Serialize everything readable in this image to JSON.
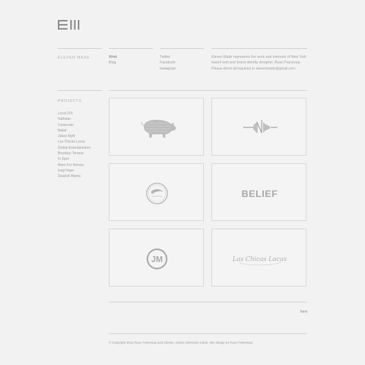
{
  "brand": {
    "name": "ELEVEN MADE"
  },
  "nav": {
    "primary": [
      "Work",
      "Blog"
    ],
    "social": [
      "Twitter",
      "Facebook",
      "Instagram"
    ]
  },
  "about": {
    "line1": "Eleven Made represents the work and interests of New York",
    "line2": "based web and brand identity designer, Ryan Pasnesaa.",
    "line3": "Please direct all inquiries to elevenmade@gmail.com"
  },
  "projects": {
    "title": "PROJECTS",
    "items": [
      "Local 215",
      "Nathaan",
      "Centerolio",
      "Belief",
      "Jokes Myth",
      "Las Chicas Locas",
      "Global Entertainment",
      "Brooklyn Terrace",
      "In Spot",
      "Bees For Heroes",
      "Iraqi Hope",
      "Seasick Mama"
    ]
  },
  "tiles": {
    "belief_wordmark": "BELIEF",
    "jm_monogram": "JM",
    "script_wordmark": "Las Chicas Locas"
  },
  "pagination": {
    "next": "Next"
  },
  "footer": {
    "text": "© Copyright 2012 Ryan Pasnesaa and Clients, unless otherwise noted. Site design by Ryan Pasnesaa."
  },
  "colors": {
    "background": "#f2f2f2",
    "text": "#9a9a9a",
    "rule": "#cfcfcf",
    "tile_border": "#d6d6d6",
    "logo": "#8c8c8c"
  }
}
